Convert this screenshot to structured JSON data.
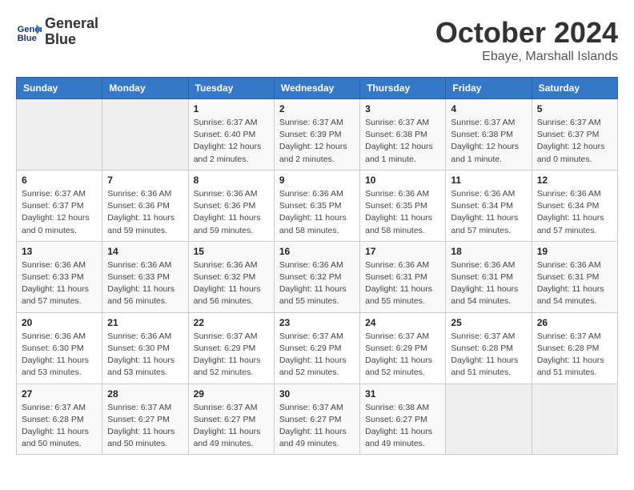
{
  "logo": {
    "line1": "General",
    "line2": "Blue"
  },
  "title": {
    "month": "October 2024",
    "location": "Ebaye, Marshall Islands"
  },
  "weekdays": [
    "Sunday",
    "Monday",
    "Tuesday",
    "Wednesday",
    "Thursday",
    "Friday",
    "Saturday"
  ],
  "weeks": [
    [
      {
        "day": "",
        "info": ""
      },
      {
        "day": "",
        "info": ""
      },
      {
        "day": "1",
        "info": "Sunrise: 6:37 AM\nSunset: 6:40 PM\nDaylight: 12 hours\nand 2 minutes."
      },
      {
        "day": "2",
        "info": "Sunrise: 6:37 AM\nSunset: 6:39 PM\nDaylight: 12 hours\nand 2 minutes."
      },
      {
        "day": "3",
        "info": "Sunrise: 6:37 AM\nSunset: 6:38 PM\nDaylight: 12 hours\nand 1 minute."
      },
      {
        "day": "4",
        "info": "Sunrise: 6:37 AM\nSunset: 6:38 PM\nDaylight: 12 hours\nand 1 minute."
      },
      {
        "day": "5",
        "info": "Sunrise: 6:37 AM\nSunset: 6:37 PM\nDaylight: 12 hours\nand 0 minutes."
      }
    ],
    [
      {
        "day": "6",
        "info": "Sunrise: 6:37 AM\nSunset: 6:37 PM\nDaylight: 12 hours\nand 0 minutes."
      },
      {
        "day": "7",
        "info": "Sunrise: 6:36 AM\nSunset: 6:36 PM\nDaylight: 11 hours\nand 59 minutes."
      },
      {
        "day": "8",
        "info": "Sunrise: 6:36 AM\nSunset: 6:36 PM\nDaylight: 11 hours\nand 59 minutes."
      },
      {
        "day": "9",
        "info": "Sunrise: 6:36 AM\nSunset: 6:35 PM\nDaylight: 11 hours\nand 58 minutes."
      },
      {
        "day": "10",
        "info": "Sunrise: 6:36 AM\nSunset: 6:35 PM\nDaylight: 11 hours\nand 58 minutes."
      },
      {
        "day": "11",
        "info": "Sunrise: 6:36 AM\nSunset: 6:34 PM\nDaylight: 11 hours\nand 57 minutes."
      },
      {
        "day": "12",
        "info": "Sunrise: 6:36 AM\nSunset: 6:34 PM\nDaylight: 11 hours\nand 57 minutes."
      }
    ],
    [
      {
        "day": "13",
        "info": "Sunrise: 6:36 AM\nSunset: 6:33 PM\nDaylight: 11 hours\nand 57 minutes."
      },
      {
        "day": "14",
        "info": "Sunrise: 6:36 AM\nSunset: 6:33 PM\nDaylight: 11 hours\nand 56 minutes."
      },
      {
        "day": "15",
        "info": "Sunrise: 6:36 AM\nSunset: 6:32 PM\nDaylight: 11 hours\nand 56 minutes."
      },
      {
        "day": "16",
        "info": "Sunrise: 6:36 AM\nSunset: 6:32 PM\nDaylight: 11 hours\nand 55 minutes."
      },
      {
        "day": "17",
        "info": "Sunrise: 6:36 AM\nSunset: 6:31 PM\nDaylight: 11 hours\nand 55 minutes."
      },
      {
        "day": "18",
        "info": "Sunrise: 6:36 AM\nSunset: 6:31 PM\nDaylight: 11 hours\nand 54 minutes."
      },
      {
        "day": "19",
        "info": "Sunrise: 6:36 AM\nSunset: 6:31 PM\nDaylight: 11 hours\nand 54 minutes."
      }
    ],
    [
      {
        "day": "20",
        "info": "Sunrise: 6:36 AM\nSunset: 6:30 PM\nDaylight: 11 hours\nand 53 minutes."
      },
      {
        "day": "21",
        "info": "Sunrise: 6:36 AM\nSunset: 6:30 PM\nDaylight: 11 hours\nand 53 minutes."
      },
      {
        "day": "22",
        "info": "Sunrise: 6:37 AM\nSunset: 6:29 PM\nDaylight: 11 hours\nand 52 minutes."
      },
      {
        "day": "23",
        "info": "Sunrise: 6:37 AM\nSunset: 6:29 PM\nDaylight: 11 hours\nand 52 minutes."
      },
      {
        "day": "24",
        "info": "Sunrise: 6:37 AM\nSunset: 6:29 PM\nDaylight: 11 hours\nand 52 minutes."
      },
      {
        "day": "25",
        "info": "Sunrise: 6:37 AM\nSunset: 6:28 PM\nDaylight: 11 hours\nand 51 minutes."
      },
      {
        "day": "26",
        "info": "Sunrise: 6:37 AM\nSunset: 6:28 PM\nDaylight: 11 hours\nand 51 minutes."
      }
    ],
    [
      {
        "day": "27",
        "info": "Sunrise: 6:37 AM\nSunset: 6:28 PM\nDaylight: 11 hours\nand 50 minutes."
      },
      {
        "day": "28",
        "info": "Sunrise: 6:37 AM\nSunset: 6:27 PM\nDaylight: 11 hours\nand 50 minutes."
      },
      {
        "day": "29",
        "info": "Sunrise: 6:37 AM\nSunset: 6:27 PM\nDaylight: 11 hours\nand 49 minutes."
      },
      {
        "day": "30",
        "info": "Sunrise: 6:37 AM\nSunset: 6:27 PM\nDaylight: 11 hours\nand 49 minutes."
      },
      {
        "day": "31",
        "info": "Sunrise: 6:38 AM\nSunset: 6:27 PM\nDaylight: 11 hours\nand 49 minutes."
      },
      {
        "day": "",
        "info": ""
      },
      {
        "day": "",
        "info": ""
      }
    ]
  ]
}
